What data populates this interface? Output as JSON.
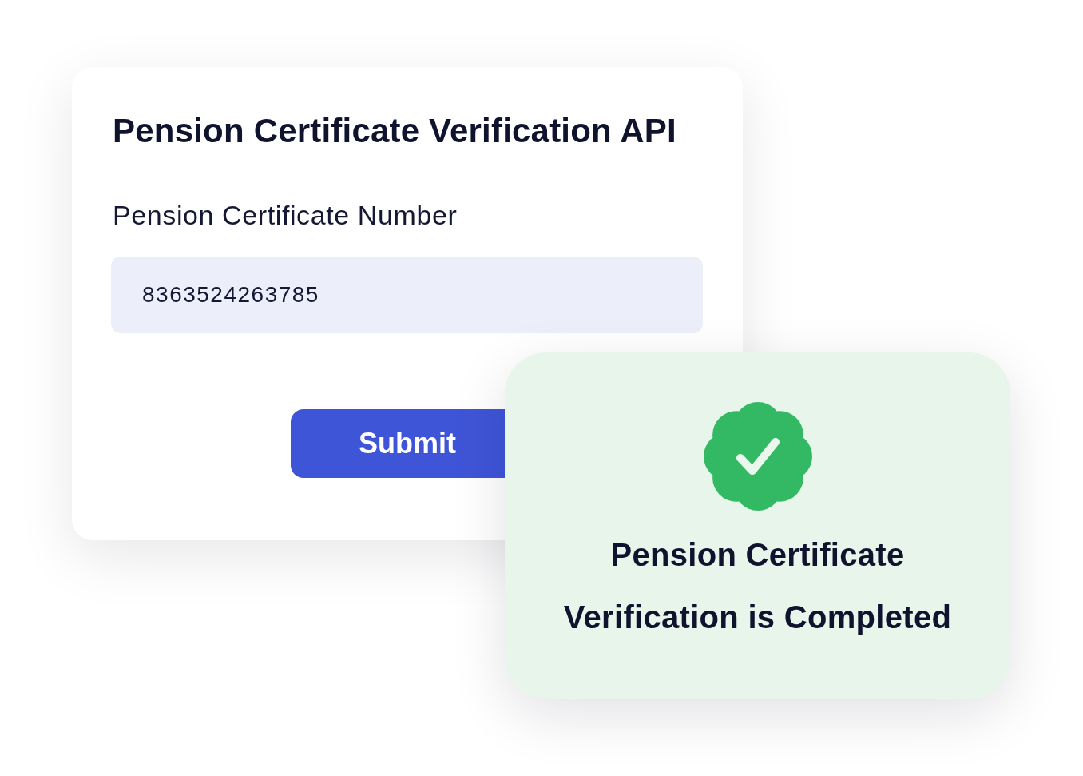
{
  "form_card": {
    "title": "Pension Certificate Verification API",
    "field": {
      "label": "Pension Certificate Number",
      "value": "8363524263785"
    },
    "submit_button": "Submit"
  },
  "result_card": {
    "kind": "success",
    "lines": [
      "Pension Certificate",
      "Verification is Completed"
    ]
  }
}
